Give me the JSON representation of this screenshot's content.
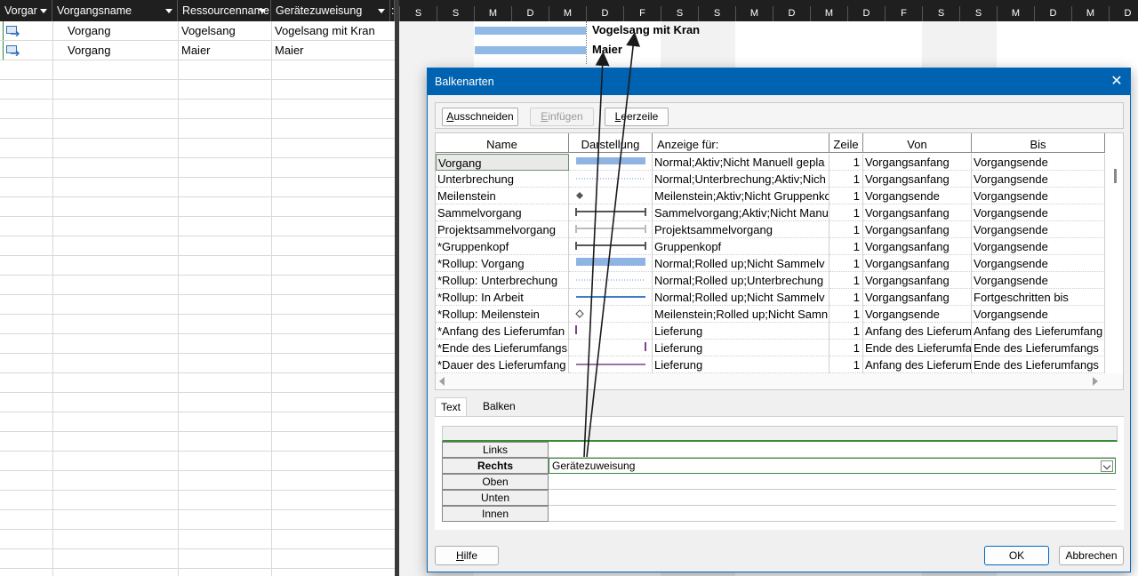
{
  "table": {
    "headers": [
      "Vorgar",
      "Vorgangsname",
      "Ressourcenname",
      "Gerätezuweisung",
      ":"
    ],
    "rows": [
      {
        "name": "Vorgang",
        "resource": "Vogelsang",
        "equipment": "Vogelsang mit Kran"
      },
      {
        "name": "Vorgang",
        "resource": "Maier",
        "equipment": "Maier"
      }
    ]
  },
  "gantt": {
    "days": [
      "S",
      "S",
      "M",
      "D",
      "M",
      "D",
      "F",
      "S",
      "S",
      "M",
      "D",
      "M",
      "D",
      "F",
      "S",
      "S",
      "M",
      "D",
      "M",
      "D"
    ],
    "bar_labels": [
      "Vogelsang mit Kran",
      "Maier"
    ]
  },
  "dialog": {
    "title": "Balkenarten",
    "toolbar": {
      "cut": "Ausschneiden",
      "paste": "Einfügen",
      "blank": "Leerzeile"
    },
    "columns": [
      "Name",
      "Darstellung",
      "Anzeige für:",
      "Zeile",
      "Von",
      "Bis"
    ],
    "rows": [
      {
        "name": "Vorgang",
        "show": "Normal;Aktiv;Nicht Manuell gepla",
        "row": "1",
        "from": "Vorgangsanfang",
        "to": "Vorgangsende"
      },
      {
        "name": "Unterbrechung",
        "show": "Normal;Unterbrechung;Aktiv;Nich",
        "row": "1",
        "from": "Vorgangsanfang",
        "to": "Vorgangsende"
      },
      {
        "name": "Meilenstein",
        "show": "Meilenstein;Aktiv;Nicht Gruppenkc",
        "row": "1",
        "from": "Vorgangsende",
        "to": "Vorgangsende"
      },
      {
        "name": "Sammelvorgang",
        "show": "Sammelvorgang;Aktiv;Nicht Manu",
        "row": "1",
        "from": "Vorgangsanfang",
        "to": "Vorgangsende"
      },
      {
        "name": "Projektsammelvorgang",
        "show": "Projektsammelvorgang",
        "row": "1",
        "from": "Vorgangsanfang",
        "to": "Vorgangsende"
      },
      {
        "name": "*Gruppenkopf",
        "show": "Gruppenkopf",
        "row": "1",
        "from": "Vorgangsanfang",
        "to": "Vorgangsende"
      },
      {
        "name": "*Rollup: Vorgang",
        "show": "Normal;Rolled up;Nicht Sammelv",
        "row": "1",
        "from": "Vorgangsanfang",
        "to": "Vorgangsende"
      },
      {
        "name": "*Rollup: Unterbrechung",
        "show": "Normal;Rolled up;Unterbrechung",
        "row": "1",
        "from": "Vorgangsanfang",
        "to": "Vorgangsende"
      },
      {
        "name": "*Rollup: In Arbeit",
        "show": "Normal;Rolled up;Nicht Sammelv",
        "row": "1",
        "from": "Vorgangsanfang",
        "to": "Fortgeschritten bis"
      },
      {
        "name": "*Rollup: Meilenstein",
        "show": "Meilenstein;Rolled up;Nicht Samn",
        "row": "1",
        "from": "Vorgangsende",
        "to": "Vorgangsende"
      },
      {
        "name": "*Anfang des Lieferumfan",
        "show": "Lieferung",
        "row": "1",
        "from": "Anfang des Lieferum",
        "to": "Anfang des Lieferumfang"
      },
      {
        "name": "*Ende des Lieferumfangs",
        "show": "Lieferung",
        "row": "1",
        "from": "Ende des Lieferumfa",
        "to": "Ende des Lieferumfangs"
      },
      {
        "name": "*Dauer des Lieferumfang",
        "show": "Lieferung",
        "row": "1",
        "from": "Anfang des Lieferum",
        "to": "Ende des Lieferumfangs"
      }
    ],
    "tabs": {
      "text": "Text",
      "bars": "Balken"
    },
    "text_rows": [
      {
        "label": "Links",
        "value": ""
      },
      {
        "label": "Rechts",
        "value": "Gerätezuweisung"
      },
      {
        "label": "Oben",
        "value": ""
      },
      {
        "label": "Unten",
        "value": ""
      },
      {
        "label": "Innen",
        "value": ""
      }
    ],
    "buttons": {
      "help": "Hilfe",
      "ok": "OK",
      "cancel": "Abbrechen"
    }
  },
  "colors": {
    "accent": "#0063b1",
    "bar": "#91b9e6",
    "header_bg": "#1f1f1f"
  }
}
